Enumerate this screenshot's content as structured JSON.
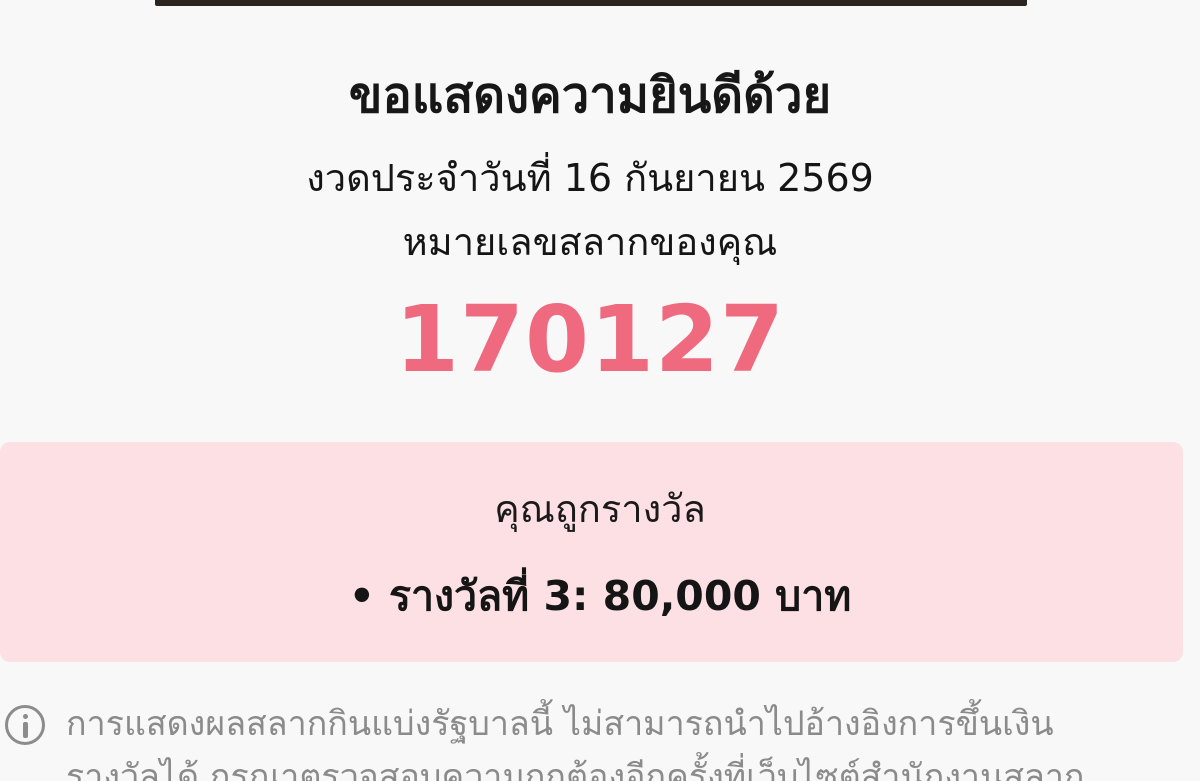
{
  "result": {
    "title": "ขอแสดงความยินดีด้วย",
    "draw_date": "งวดประจำวันที่ 16 กันยายน 2569",
    "ticket_label": "หมายเลขสลากของคุณ",
    "ticket_number": "170127"
  },
  "prize": {
    "heading": "คุณถูกรางวัล",
    "bullet": "•",
    "line": "รางวัลที่ 3: 80,000 บาท"
  },
  "notice": {
    "icon": "info-icon",
    "line1": "การแสดงผลสลากกินแบ่งรัฐบาลนี้ ไม่สามารถนำไปอ้างอิงการขึ้นเงิน",
    "line2": "รางวัลได้ กรุณาตรวจสอบความถูกต้องอีกครั้งที่เว็บไซต์สำนักงานสลาก"
  },
  "colors": {
    "accent_pink": "#f06a7f",
    "prize_background": "#fde0e4",
    "muted_text": "#8b8b8b"
  }
}
